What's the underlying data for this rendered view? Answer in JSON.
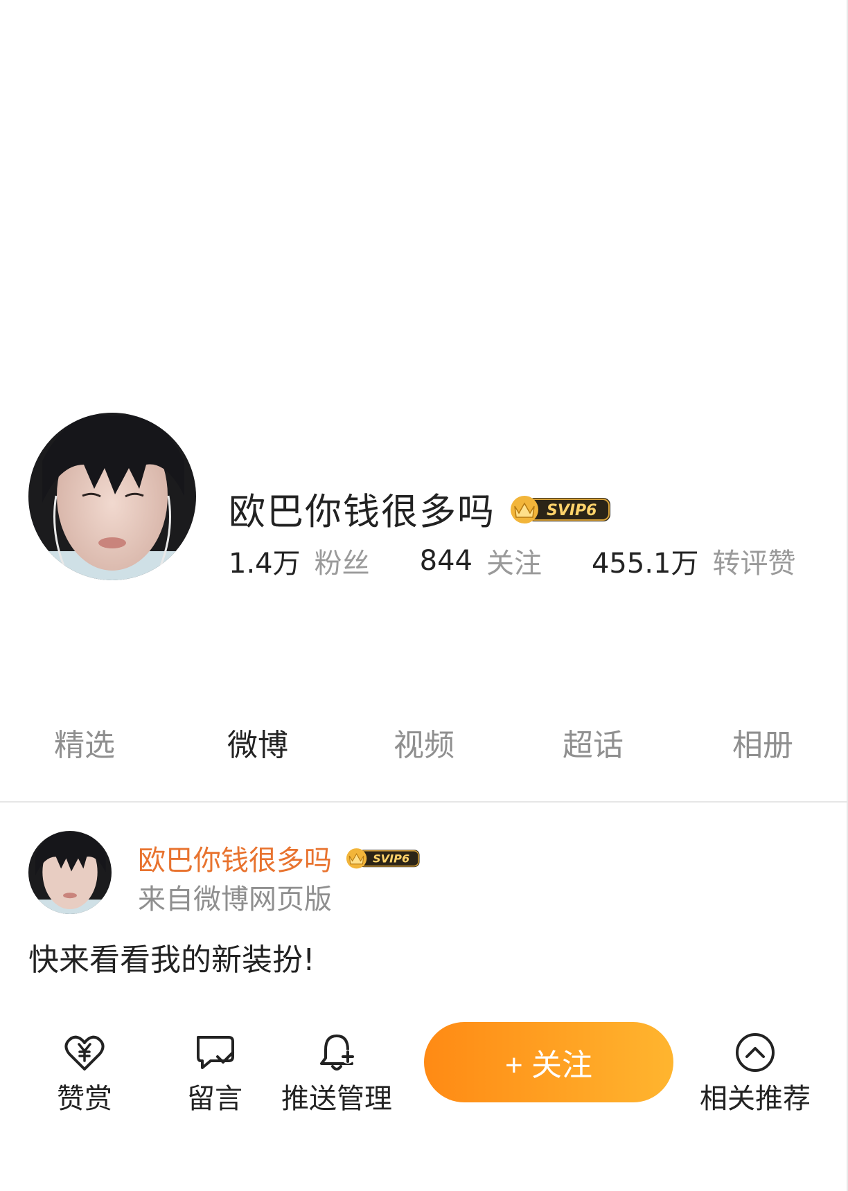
{
  "profile": {
    "name": "欧巴你钱很多吗",
    "vip_badge": "SVIP6",
    "stats": [
      {
        "value": "1.4万",
        "label": "粉丝"
      },
      {
        "value": "844",
        "label": "关注"
      },
      {
        "value": "455.1万",
        "label": "转评赞"
      }
    ]
  },
  "tabs": [
    {
      "label": "精选",
      "active": false
    },
    {
      "label": "微博",
      "active": true
    },
    {
      "label": "视频",
      "active": false
    },
    {
      "label": "超话",
      "active": false
    },
    {
      "label": "相册",
      "active": false
    }
  ],
  "post": {
    "author": "欧巴你钱很多吗",
    "vip_badge": "SVIP6",
    "source": "来自微博网页版",
    "text": "快来看看我的新装扮!"
  },
  "actions": {
    "reward": {
      "label": "赞赏",
      "icon": "heart-yen-icon"
    },
    "message": {
      "label": "留言",
      "icon": "chat-bubble-icon"
    },
    "push": {
      "label": "推送管理",
      "icon": "bell-plus-icon"
    },
    "follow": {
      "label": "+ 关注"
    },
    "related": {
      "label": "相关推荐",
      "icon": "chevron-up-circle-icon"
    }
  },
  "colors": {
    "author_orange": "#e8732f",
    "follow_gradient_start": "#ff8a14",
    "follow_gradient_end": "#ffb52f",
    "muted_text": "#8f8f8f"
  }
}
